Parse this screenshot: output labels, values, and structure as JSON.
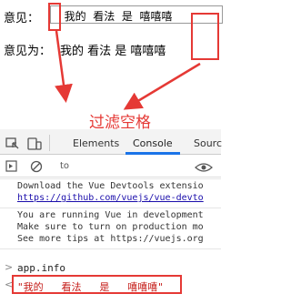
{
  "demo": {
    "row1_label": "意见：",
    "input_value": "  我的  看法  是  嘻嘻嘻",
    "row2_label": "意见为：",
    "row2_value": "我的 看法 是 嘻嘻嘻"
  },
  "annotation": "过滤空格",
  "devtools": {
    "tabs": [
      "Elements",
      "Console",
      "Sourc"
    ],
    "active_tab": "Console",
    "filter_text": "to",
    "logs": [
      [
        "Download the Vue Devtools extensio",
        "https://github.com/vuejs/vue-devto"
      ],
      [
        "You are running Vue in development",
        "Make sure to turn on production mo",
        "See more tips at https://vuejs.org"
      ]
    ],
    "prompt_command": "app.info",
    "result": "\"我的   看法   是   嘻嘻嘻\""
  },
  "colors": {
    "annotation_red": "#e53935",
    "link_blue": "#1a0dab",
    "string_red": "#c41a16",
    "tab_active": "#1a73e8"
  }
}
